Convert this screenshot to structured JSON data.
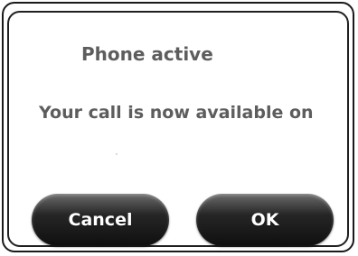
{
  "dialog": {
    "title": "Phone active",
    "message": "Your call is now available on"
  },
  "buttons": {
    "cancel_label": "Cancel",
    "ok_label": "OK"
  },
  "colors": {
    "text_gray": "#5d5d5d",
    "button_dark": "#1a1a1a"
  }
}
